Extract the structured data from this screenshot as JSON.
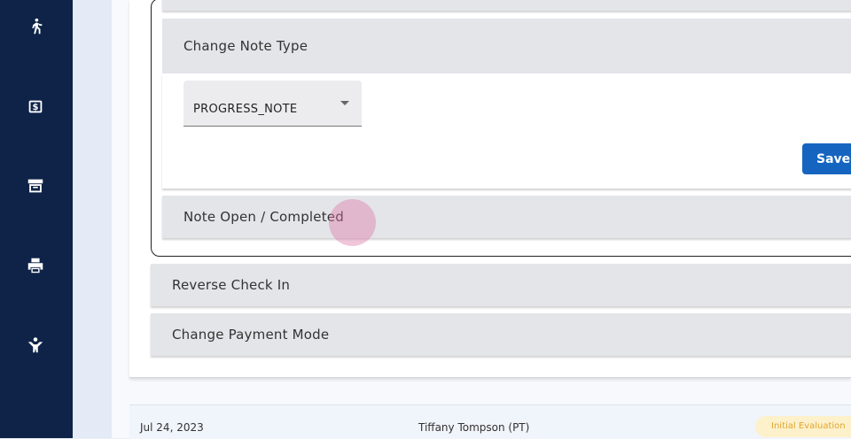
{
  "sidebar": {
    "items": [
      {
        "icon": "walking-person-icon"
      },
      {
        "icon": "dollar-box-icon"
      },
      {
        "icon": "archive-icon"
      },
      {
        "icon": "printer-icon"
      },
      {
        "icon": "person-support-icon"
      }
    ]
  },
  "accordions": {
    "change_note_type": {
      "title": "Change Note Type",
      "select_value": "PROGRESS_NOTE",
      "save_label": "Save"
    },
    "note_open_completed": {
      "title": "Note Open / Completed"
    },
    "reverse_check_in": {
      "title": "Reverse Check In"
    },
    "change_payment_mode": {
      "title": "Change Payment Mode"
    }
  },
  "visit_row": {
    "date": "Jul 24, 2023",
    "provider": "Tiffany Tompson (PT)",
    "badge": "Initial Evaluation"
  },
  "colors": {
    "sidebar": "#0e2347",
    "primary_button": "#1565c0",
    "badge_bg": "#fdf1cc",
    "badge_text": "#e0a530"
  }
}
